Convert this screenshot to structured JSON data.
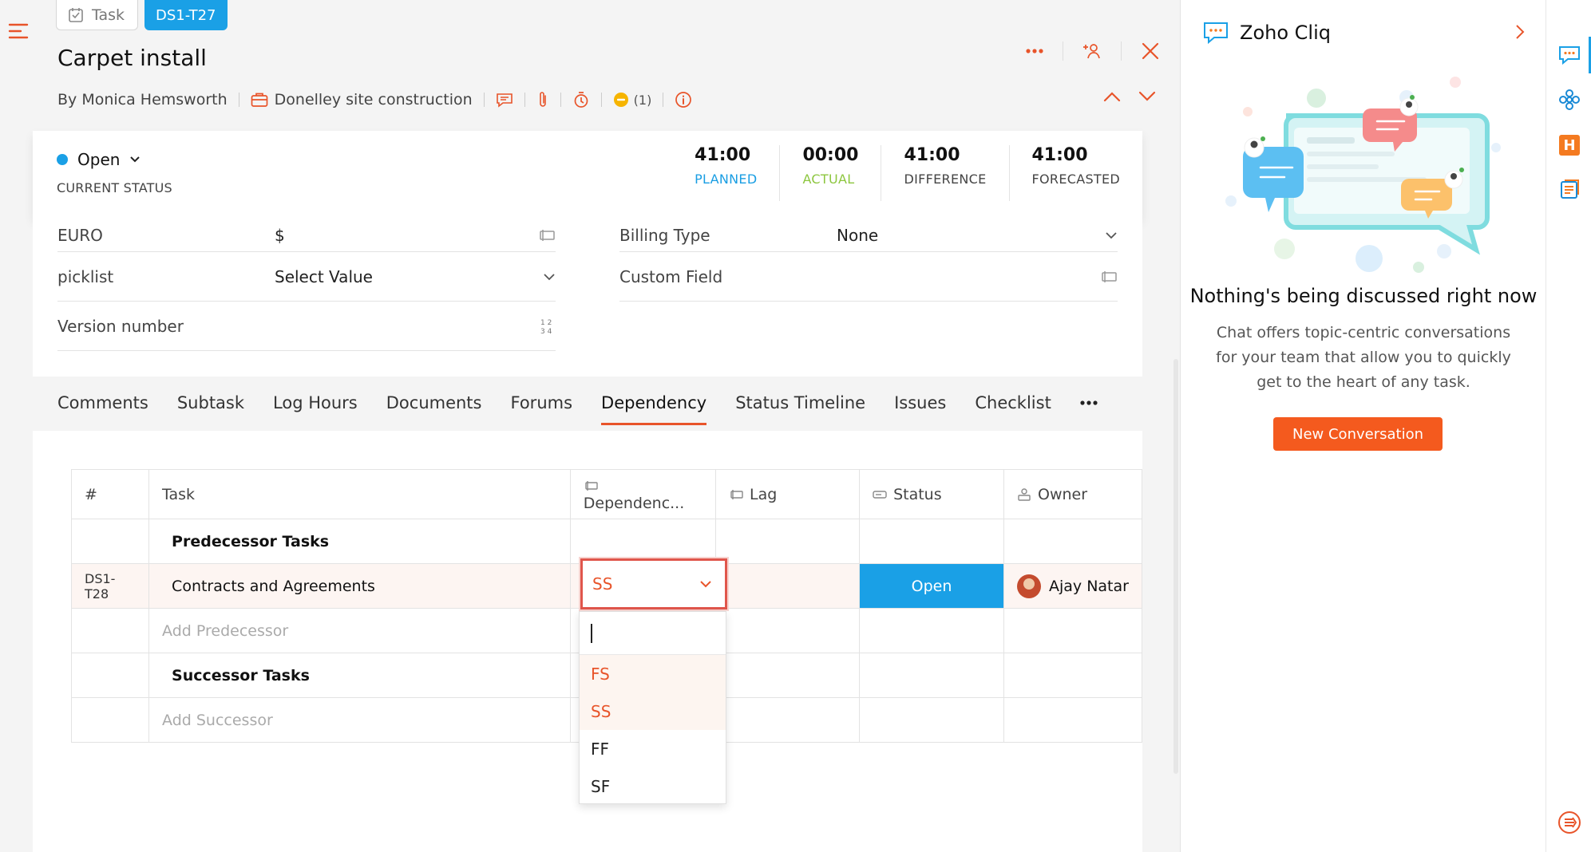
{
  "header": {
    "type_chip": "Task",
    "task_id": "DS1-T27",
    "title": "Carpet install",
    "author": "By Monica Hemsworth",
    "project": "Donelley site construction",
    "reminder_count": "(1)"
  },
  "status": {
    "value": "Open",
    "caption": "CURRENT STATUS",
    "metrics": [
      {
        "value": "41:00",
        "label": "PLANNED",
        "color": "#1a9ee3"
      },
      {
        "value": "00:00",
        "label": "ACTUAL",
        "color": "#8dc63f"
      },
      {
        "value": "41:00",
        "label": "DIFFERENCE",
        "color": "#444444"
      },
      {
        "value": "41:00",
        "label": "FORECASTED",
        "color": "#444444"
      }
    ]
  },
  "fields": {
    "euro_label": "EURO",
    "euro_value": "$",
    "billing_label": "Billing Type",
    "billing_value": "None",
    "picklist_label": "picklist",
    "picklist_value": "Select Value",
    "custom_label": "Custom Field",
    "version_label": "Version number"
  },
  "tabs": [
    "Comments",
    "Subtask",
    "Log Hours",
    "Documents",
    "Forums",
    "Dependency",
    "Status Timeline",
    "Issues",
    "Checklist"
  ],
  "active_tab": "Dependency",
  "table": {
    "headers": {
      "num": "#",
      "task": "Task",
      "dependency": "Dependenc...",
      "lag": "Lag",
      "status": "Status",
      "owner": "Owner"
    },
    "predecessor_heading": "Predecessor Tasks",
    "row": {
      "id": "DS1-T28",
      "task": "Contracts and Agreements",
      "dependency": "SS",
      "status": "Open",
      "owner": "Ajay Natar"
    },
    "add_predecessor": "Add Predecessor",
    "successor_heading": "Successor Tasks",
    "add_successor": "Add Successor"
  },
  "dependency_options": [
    "FS",
    "SS",
    "FF",
    "SF"
  ],
  "cliq": {
    "title": "Zoho Cliq",
    "empty_title": "Nothing's being discussed right now",
    "empty_desc": "Chat offers topic-centric conversations for your team that allow you to quickly get to the heart of any task.",
    "button": "New Conversation"
  },
  "colors": {
    "accent": "#e8542a",
    "blue": "#1aa0e6",
    "button_orange": "#f45a1e"
  }
}
